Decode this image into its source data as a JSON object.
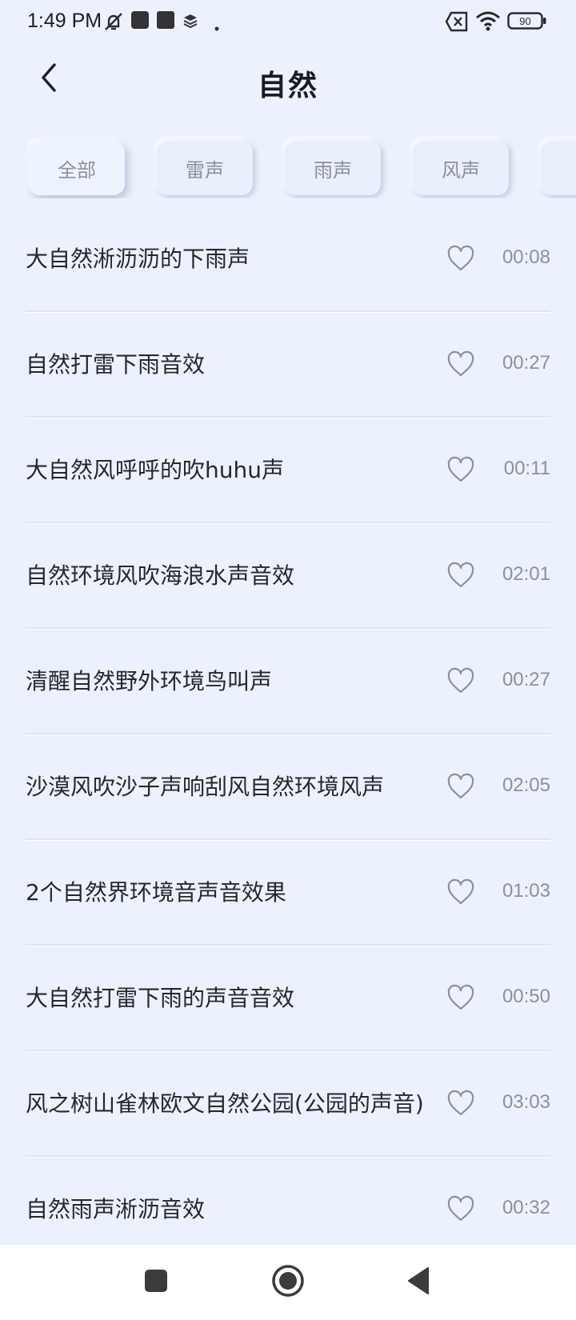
{
  "status_bar": {
    "time": "1:49 PM",
    "battery_level": "90",
    "icons": [
      "mute-icon",
      "app-notification-icon",
      "app-notification-icon",
      "layers-icon",
      "dot-icon",
      "no-sim-icon",
      "wifi-icon",
      "battery-icon"
    ]
  },
  "header": {
    "title": "自然",
    "back_icon": "chevron-left-icon"
  },
  "tabs": [
    {
      "label": "全部",
      "active": true
    },
    {
      "label": "雷声",
      "active": false
    },
    {
      "label": "雨声",
      "active": false
    },
    {
      "label": "风声",
      "active": false
    },
    {
      "label": "",
      "active": false
    }
  ],
  "tracks": [
    {
      "title": "大自然淅沥沥的下雨声",
      "duration": "00:08"
    },
    {
      "title": "自然打雷下雨音效",
      "duration": "00:27"
    },
    {
      "title": "大自然风呼呼的吹huhu声",
      "duration": "00:11"
    },
    {
      "title": "自然环境风吹海浪水声音效",
      "duration": "02:01"
    },
    {
      "title": "清醒自然野外环境鸟叫声",
      "duration": "00:27"
    },
    {
      "title": "沙漠风吹沙子声响刮风自然环境风声",
      "duration": "02:05"
    },
    {
      "title": "2个自然界环境音声音效果",
      "duration": "01:03"
    },
    {
      "title": "大自然打雷下雨的声音音效",
      "duration": "00:50"
    },
    {
      "title": "风之树山雀林欧文自然公园(公园的声音)",
      "duration": "03:03"
    },
    {
      "title": "自然雨声淅沥音效",
      "duration": "00:32"
    }
  ],
  "nav_bar": {
    "icons": [
      "recents-square-icon",
      "home-circle-icon",
      "back-triangle-icon"
    ]
  },
  "colors": {
    "background": "#ebf2fd",
    "text": "#27272b",
    "muted": "#8d9099",
    "nav_background": "#ffffff"
  }
}
